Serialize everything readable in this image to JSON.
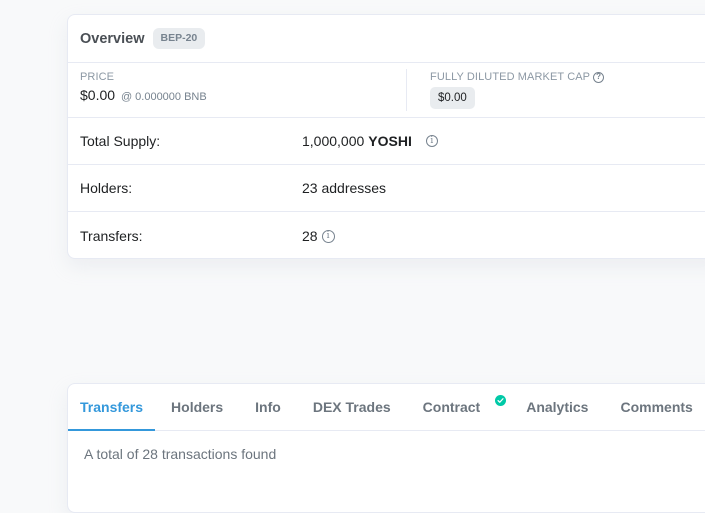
{
  "overview": {
    "title": "Overview",
    "token_standard": "BEP-20",
    "price_label": "PRICE",
    "price_value": "$0.00",
    "price_bnb": "@ 0.000000 BNB",
    "mcap_label": "FULLY DILUTED MARKET CAP",
    "mcap_value": "$0.00",
    "rows": [
      {
        "label": "Total Supply:",
        "value": "1,000,000",
        "symbol": "YOSHI"
      },
      {
        "label": "Holders:",
        "value": "23 addresses"
      },
      {
        "label": "Transfers:",
        "value": "28"
      }
    ]
  },
  "tabs": {
    "items": [
      {
        "label": "Transfers",
        "active": true
      },
      {
        "label": "Holders"
      },
      {
        "label": "Info"
      },
      {
        "label": "DEX Trades"
      },
      {
        "label": "Contract",
        "verified": true
      },
      {
        "label": "Analytics"
      },
      {
        "label": "Comments"
      }
    ],
    "summary": "A total of 28 transactions found"
  },
  "colors": {
    "accent": "#3498db",
    "verified": "#00c9a7",
    "page_bg": "#f8f9fa"
  }
}
